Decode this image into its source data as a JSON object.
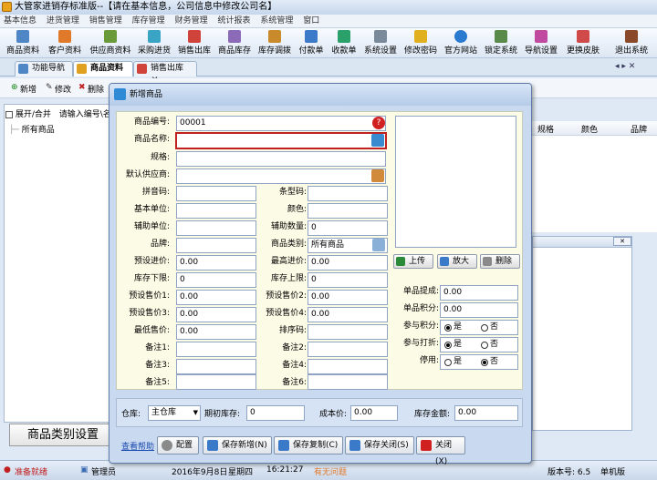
{
  "app": {
    "title": "大管家进销存标准版--【请在基本信息，公司信息中修改公司名】"
  },
  "menu": [
    "基本信息",
    "进货管理",
    "销售管理",
    "库存管理",
    "财务管理",
    "统计报表",
    "系统管理",
    "窗口"
  ],
  "toolbar": [
    "商品资料",
    "客户资料",
    "供应商资料",
    "采购进货",
    "销售出库",
    "商品库存",
    "库存调拨",
    "付款单",
    "收款单",
    "系统设置",
    "修改密码",
    "官方网站",
    "锁定系统",
    "导航设置",
    "更换皮肤",
    "退出系统"
  ],
  "tabs": [
    "功能导航",
    "商品资料",
    "销售出库单"
  ],
  "subbar": {
    "add": "新增",
    "edit": "修改",
    "delete": "删除"
  },
  "tree": {
    "expand": "展开/合并",
    "search": "请输入编号\\名",
    "root": "所有商品"
  },
  "grid": {
    "cols": [
      "规格",
      "颜色",
      "品牌"
    ]
  },
  "category_btn": "商品类别设置",
  "statusbar": {
    "ready": "准备就绪",
    "user": "管理员",
    "date": "2016年9月8日",
    "weekday": "星期四",
    "time": "16:21:27",
    "msg": "有无问题",
    "version": "版本号: 6.5",
    "mode": "单机版"
  },
  "dialog": {
    "title": "新增商品",
    "labels": {
      "code": "商品编号:",
      "name": "商品名称:",
      "spec": "规格:",
      "supplier": "默认供应商:",
      "pinyin": "拼音码:",
      "barcode": "条型码:",
      "base_unit": "基本单位:",
      "color": "颜色:",
      "aux_unit": "辅助单位:",
      "aux_qty": "辅助数量:",
      "brand": "品牌:",
      "category": "商品类别:",
      "pre_price": "预设进价:",
      "max_price": "最高进价:",
      "stock_min": "库存下限:",
      "stock_max": "库存上限:",
      "sale1": "预设售价1:",
      "sale2": "预设售价2:",
      "sale3": "预设售价3:",
      "sale4": "预设售价4:",
      "min_sale": "最低售价:",
      "sort": "排序码:",
      "note1": "备注1:",
      "note2": "备注2:",
      "note3": "备注3:",
      "note4": "备注4:",
      "note5": "备注5:",
      "note6": "备注6:",
      "commission": "单品提成:",
      "points": "单品积分:",
      "in_points": "参与积分:",
      "in_discount": "参与打折:",
      "disabled": "停用:"
    },
    "values": {
      "code": "00001",
      "aux_qty": "0",
      "category": "所有商品",
      "pre_price": "0.00",
      "max_price": "0.00",
      "stock_min": "0",
      "stock_max": "0",
      "sale1": "0.00",
      "sale2": "0.00",
      "sale3": "0.00",
      "sale4": "0.00",
      "min_sale": "0.00",
      "commission": "0.00",
      "points": "0.00"
    },
    "radio": {
      "yes": "是",
      "no": "否"
    },
    "image_buttons": {
      "upload": "上传",
      "zoom": "放大",
      "delete": "删除"
    },
    "bottom": {
      "warehouse_label": "仓库:",
      "warehouse": "主仓库",
      "init_stock_label": "期初库存:",
      "init_stock": "0",
      "cost_label": "成本价:",
      "cost": "0.00",
      "amount_label": "库存金额:",
      "amount": "0.00"
    },
    "footer": {
      "help": "查看帮助",
      "config": "配置",
      "save_new": "保存新增(N)",
      "save_copy": "保存复制(C)",
      "save_close": "保存关闭(S)",
      "close": "关闭(X)"
    }
  }
}
